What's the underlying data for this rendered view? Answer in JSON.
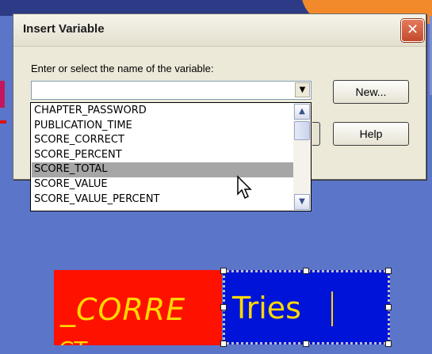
{
  "dialog": {
    "title": "Insert Variable",
    "close_icon": "close-icon",
    "prompt": "Enter or select the name of the variable:",
    "variable_input": {
      "value": "",
      "placeholder": ""
    },
    "buttons": {
      "new": "New...",
      "help": "Help"
    }
  },
  "dropdown": {
    "items": [
      "CHAPTER_PASSWORD",
      "PUBLICATION_TIME",
      "SCORE_CORRECT",
      "SCORE_PERCENT",
      "SCORE_TOTAL",
      "SCORE_VALUE",
      "SCORE_VALUE_PERCENT"
    ],
    "selected": "SCORE_TOTAL"
  },
  "canvas": {
    "red_box_text": "_CORRE",
    "red_box_text_line2": "CT",
    "blue_box_text": "Tries"
  },
  "colors": {
    "background": "#5b75c9",
    "red_box": "#ff1100",
    "blue_box": "#0014d9",
    "text_yellow": "#ffd800",
    "selection": "#a6a6a6"
  }
}
